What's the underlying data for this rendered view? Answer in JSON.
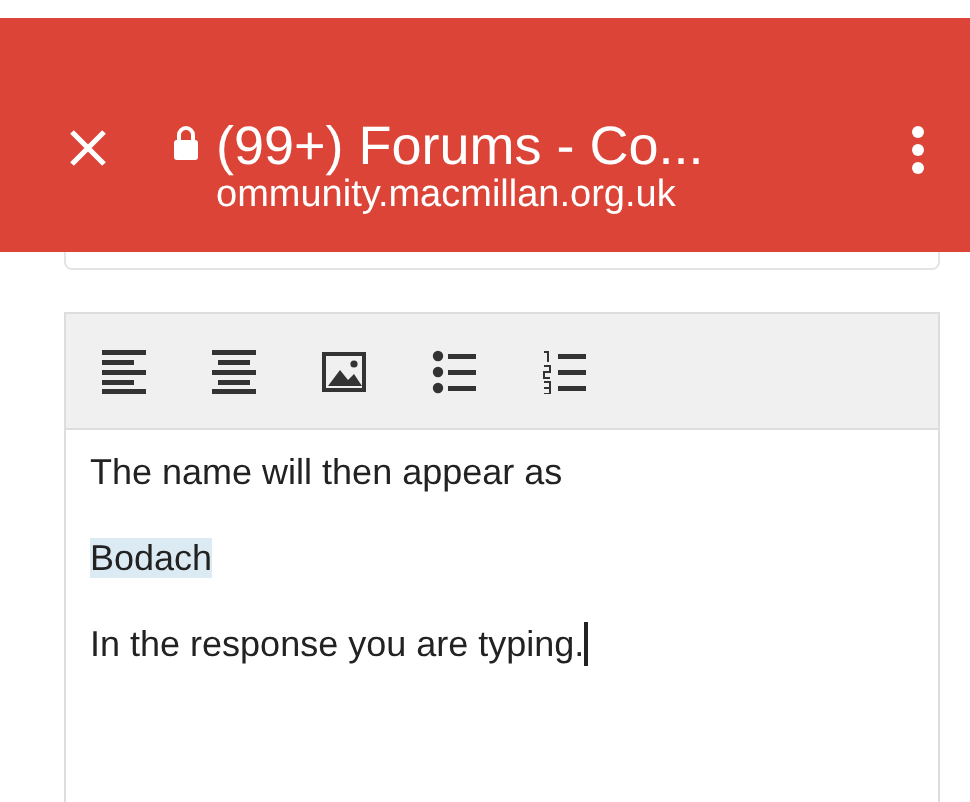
{
  "app_bar": {
    "title": "(99+) Forums - Co...",
    "url": "ommunity.macmillan.org.uk",
    "secure": true
  },
  "toolbar": [
    {
      "kind": "align-left"
    },
    {
      "kind": "align-center"
    },
    {
      "kind": "image"
    },
    {
      "kind": "bullet-list"
    },
    {
      "kind": "numbered-list"
    }
  ],
  "paragraphs": [
    {
      "text": "The name will then appear as",
      "highlighted": false,
      "caret": false
    },
    {
      "text": "Bodach",
      "highlighted": true,
      "caret": false
    },
    {
      "text": "In the response you are typing.",
      "highlighted": false,
      "caret": true
    }
  ]
}
